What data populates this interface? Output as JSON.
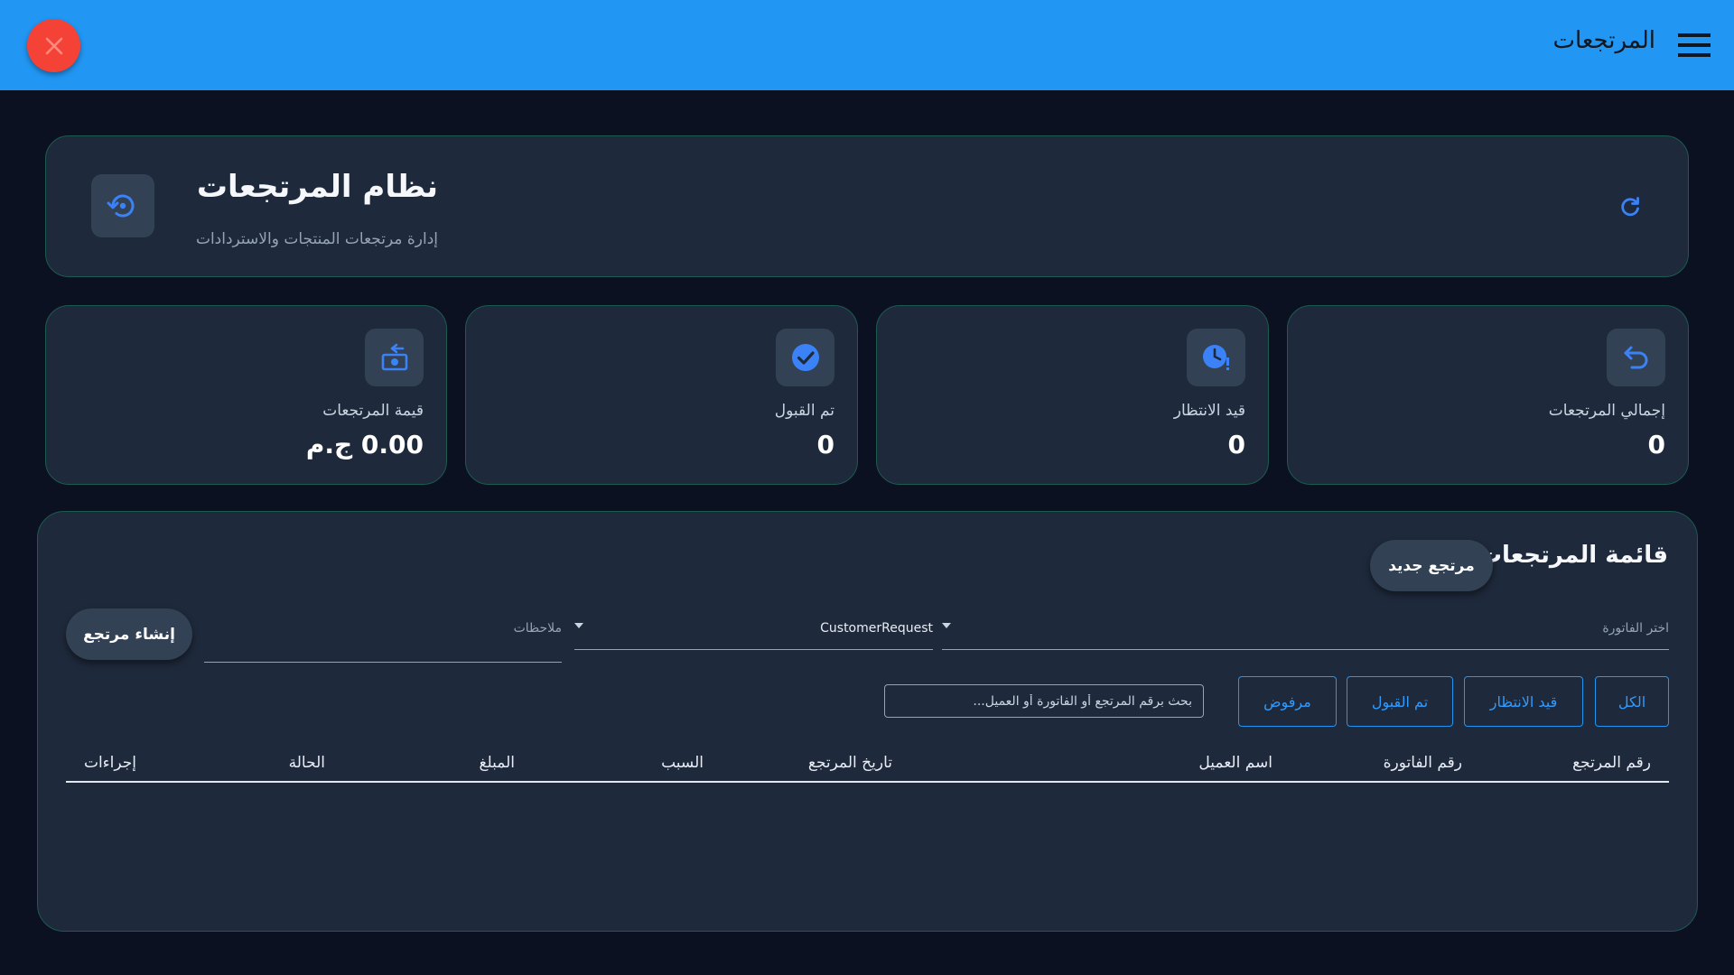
{
  "appbar": {
    "title": "المرتجعات",
    "close_icon": "close-icon",
    "menu_icon": "hamburger-menu-icon",
    "colors": {
      "bar": "#2196f3",
      "close": "#f44336"
    }
  },
  "header": {
    "title": "نظام المرتجعات",
    "subtitle": "إدارة مرتجعات المنتجات والاستردادات",
    "icon": "restore-icon",
    "refresh_icon": "refresh-icon"
  },
  "stats": [
    {
      "label": "إجمالي المرتجعات",
      "value": "0",
      "icon": "undo-arrow-icon"
    },
    {
      "label": "قيد الانتظار",
      "value": "0",
      "icon": "clock-alert-icon"
    },
    {
      "label": "تم القبول",
      "value": "0",
      "icon": "check-circle-icon"
    },
    {
      "label": "قيمة المرتجعات",
      "value": "0.00 ج.م",
      "icon": "cash-refund-icon"
    }
  ],
  "returns_panel": {
    "title": "قائمة المرتجعات",
    "new_return_label": "مرتجع جديد",
    "create_return_label": "إنشاء مرتجع",
    "invoice_placeholder": "اختر الفاتورة",
    "reason_value": "CustomerRequest",
    "notes_placeholder": "ملاحظات",
    "filters": [
      "الكل",
      "قيد الانتظار",
      "تم القبول",
      "مرفوض"
    ],
    "search_placeholder": "بحث برقم المرتجع أو الفاتورة أو العميل...",
    "columns": [
      "رقم المرتجع",
      "رقم الفاتورة",
      "اسم العميل",
      "تاريخ المرتجع",
      "السبب",
      "المبلغ",
      "الحالة",
      "إجراءات"
    ]
  },
  "colors": {
    "accent": "#2196f3",
    "card_border": "#1d5a4f",
    "icon_blue": "#3b82f6"
  }
}
